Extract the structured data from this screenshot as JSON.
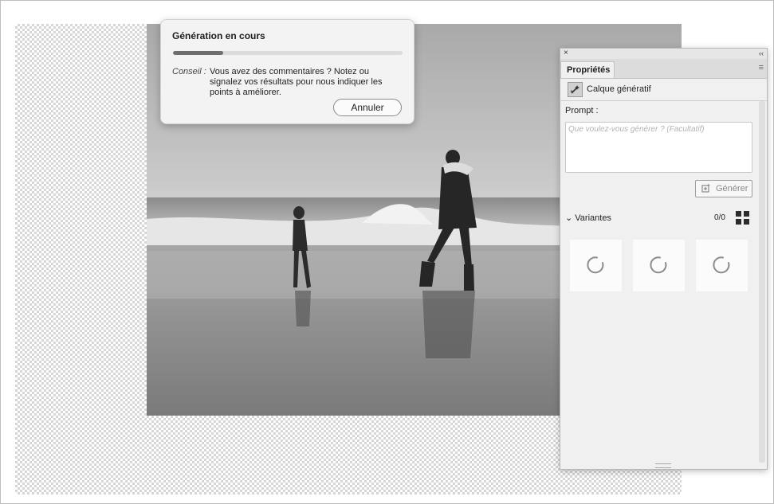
{
  "toast": {
    "title": "Génération en cours",
    "progress": 0.22,
    "tip_label": "Conseil :",
    "tip_text": "Vous avez des commentaires ? Notez ou signalez vos résultats pour nous indiquer les points à améliorer.",
    "cancel_label": "Annuler"
  },
  "panel": {
    "close_glyph": "×",
    "collapse_glyph": "‹‹",
    "tab_label": "Propriétés",
    "menu_glyph": "≡",
    "layer_name": "Calque génératif",
    "layer_icon": "generative-fill-icon",
    "prompt_label": "Prompt :",
    "prompt_placeholder": "Que voulez-vous générer ?  (Facultatif)",
    "generate_label": "Générer",
    "generate_icon": "generate-icon",
    "variants_label": "Variantes",
    "variants_chevron": "⌄",
    "variants_count": "0/0",
    "grid_icon": "grid-view-icon",
    "variant_thumbnails": [
      "loading-spinner",
      "loading-spinner",
      "loading-spinner"
    ]
  },
  "canvas": {
    "background": "transparency-checkerboard",
    "image": "beach-photo-grayscale"
  }
}
